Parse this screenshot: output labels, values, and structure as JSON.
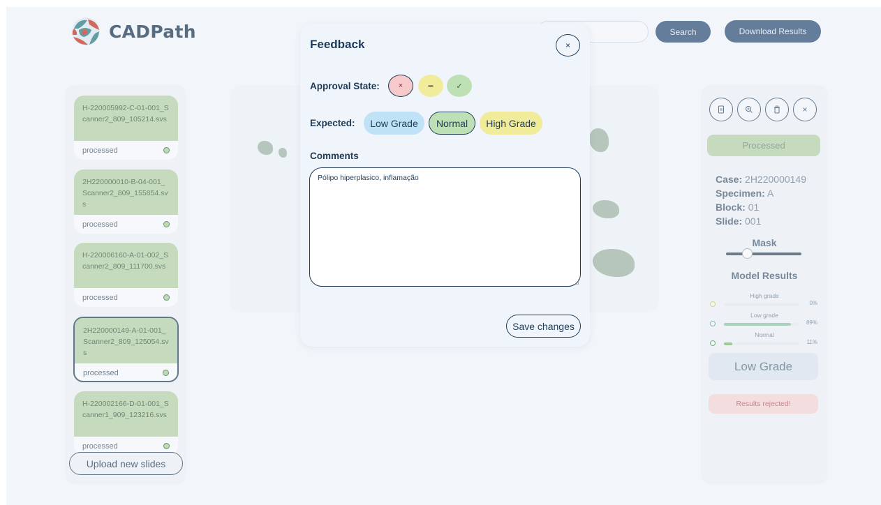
{
  "app": {
    "name": "CADPath"
  },
  "header": {
    "search_placeholder": "",
    "search_label": "Search",
    "download_label": "Download Results"
  },
  "slides": [
    {
      "name": "H-220005992-C-01-001_Scanner2_809_105214.svs",
      "status": "processed",
      "selected": false
    },
    {
      "name": "2H220000010-B-04-001_Scanner2_809_155854.svs",
      "status": "processed",
      "selected": false
    },
    {
      "name": "H-220006160-A-01-002_Scanner2_809_111700.svs",
      "status": "processed",
      "selected": false
    },
    {
      "name": "2H220000149-A-01-001_Scanner2_809_125054.svs",
      "status": "processed",
      "selected": true
    },
    {
      "name": "H-220002166-D-01-001_Scanner1_909_123216.svs",
      "status": "processed",
      "selected": false
    }
  ],
  "upload_label": "Upload new slides",
  "right_panel": {
    "status_badge": "Processed",
    "case_label": "Case:",
    "case_value": "2H220000149",
    "specimen_label": "Specimen:",
    "specimen_value": "A",
    "block_label": "Block:",
    "block_value": "01",
    "slide_label": "Slide:",
    "slide_value": "001",
    "mask_label": "Mask",
    "mask_value": 0.25,
    "model_results_title": "Model Results",
    "results": [
      {
        "label": "High grade",
        "percent_text": "0%",
        "value": 0,
        "color": "#c9c25a",
        "fill": "#c9c25a"
      },
      {
        "label": "Low grade",
        "percent_text": "89%",
        "value": 0.89,
        "color": "#5aa0b5",
        "fill": "#8cc3a6"
      },
      {
        "label": "Normal",
        "percent_text": "11%",
        "value": 0.11,
        "color": "#4e8f55",
        "fill": "#7ab86f"
      }
    ],
    "predicted_grade": "Low Grade",
    "rejected_text": "Results rejected!"
  },
  "modal": {
    "title": "Feedback",
    "close_glyph": "×",
    "approval_label": "Approval State:",
    "approval_reject_glyph": "×",
    "approval_pending_glyph": "−",
    "approval_approve_glyph": "✓",
    "expected_label": "Expected:",
    "grades": {
      "low": "Low Grade",
      "normal": "Normal",
      "high": "High Grade"
    },
    "comments_label": "Comments",
    "comments_value": "Pólipo hiperplasico, inflamação",
    "save_label": "Save changes"
  },
  "icons": {
    "right_toolbar": [
      "document-icon",
      "zoom-icon",
      "trash-icon",
      "close-icon"
    ]
  },
  "colors": {
    "primary": "#2f5278",
    "processed": "#b3cfa8",
    "low_grade": "#bfe2f6",
    "normal": "#bfe0b5",
    "high_grade": "#f1ec9c",
    "reject": "#f6c9cb"
  }
}
